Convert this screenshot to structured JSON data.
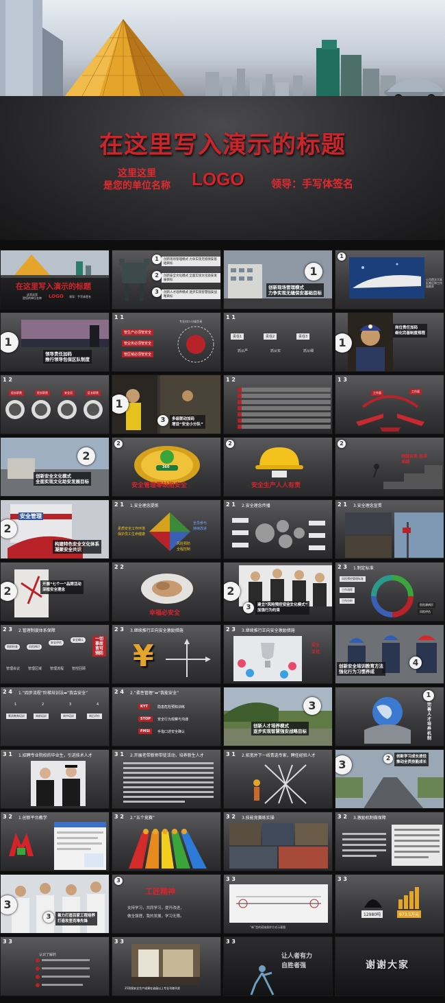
{
  "hero": {
    "title": "在这里写入演示的标题",
    "unit_line1": "这里这里",
    "unit_line2": "是您的单位名称",
    "logo": "LOGO",
    "leader": "领导：手写体签名"
  },
  "colors": {
    "accent_red": "#d4262c",
    "gold": "#e4a52a",
    "background": "#1b1b1d"
  },
  "slides": {
    "s1": {
      "title": "在这里写入演示的标题",
      "unit_a": "这里这里",
      "unit_b": "是您的单位名称",
      "logo": "LOGO",
      "leader": "领导：手写体签名"
    },
    "s2": {
      "items": [
        "创新现场管理模式 力争实现无缝保安基础目标",
        "创新安全文化模式 全面实现文化助安发展目标",
        "创新人才培养模式 逐步实现智慧强安战略目标"
      ],
      "nums": [
        "1",
        "2",
        "3"
      ]
    },
    "s3": {
      "num": "1",
      "line1": "创新现场管理模式",
      "line2": "力争实现无缝保安基础目标"
    },
    "s4": {
      "num": "1",
      "side": "公司首次大采区搬迁和工作面搬家"
    },
    "s5": {
      "num": "1",
      "line1": "领导责任加码",
      "line2": "推行领导包保区队制度"
    },
    "s6": {
      "num": "1 1",
      "items": [
        "管生产必须管安全",
        "管业务必须管安全",
        "管区域必须管安全"
      ],
      "ring": "专业对口·分级负责"
    },
    "s7": {
      "num": "1 1",
      "steps": [
        "责任1",
        "责任2",
        "责任3"
      ],
      "bottom": [
        "抓从严",
        "抓从实",
        "抓从细"
      ]
    },
    "s8": {
      "num": "1",
      "line1": "岗位责任加码",
      "line2": "细化完善制度规程"
    },
    "s9": {
      "num": "1 2",
      "labels": [
        "组长职责",
        "班长职责",
        "安全员",
        "区长职责"
      ]
    },
    "s10": {
      "num": "3",
      "line1": "多级联动加码",
      "line2": "增设“安全小分队”"
    },
    "s11": {
      "num": "1 2",
      "rows": 7
    },
    "s12": {
      "num": "1 3",
      "tags": [
        "工作面",
        "工作面"
      ]
    },
    "s13": {
      "num": "2",
      "line1": "创新安全文化模式",
      "line2": "全面实现文化助安发展目标"
    },
    "s14": {
      "num": "2",
      "badge": "360",
      "text": "安全管理零缺陷安全"
    },
    "s15": {
      "num": "2",
      "text": "安全生产人人有责"
    },
    "s16": {
      "num": "2",
      "text": "跨越自我 追求卓越"
    },
    "s17": {
      "num": "2",
      "logo_text": "安全管理",
      "line1": "构建特色安全文化体系",
      "line2": "凝聚安全共识"
    },
    "s18": {
      "num": "2 1",
      "hdr": "1.安全理念提炼",
      "left1": "素质安全工作环境",
      "left2": "保护员工生命健康",
      "right1": "全员参与",
      "right2": "持续改进",
      "bottom1": "风险预防",
      "bottom2": "全程控制"
    },
    "s19": {
      "num": "2 1",
      "hdr": "2.安全理念传播"
    },
    "s20": {
      "num": "2 1",
      "hdr": "3.安全理念宣贯"
    },
    "s21": {
      "num": "2",
      "line1": "开展“七个一”品牌活动",
      "line2": "深植安全理念"
    },
    "s22": {
      "num": "2 2",
      "text": "幸福必安全"
    },
    "s23": {
      "num": "3",
      "line1": "建立“风险预控安全文化模式”",
      "line2": "加强行为约束"
    },
    "s24": {
      "num": "2 3",
      "hdr": "1.制定标准",
      "boxes": [
        "风险预控管理标准",
        "工作流程",
        "工作分析"
      ],
      "right": [
        "危险源辨识",
        "风险评估"
      ]
    },
    "s25": {
      "num": "2 3",
      "hdr": "2.管理制度体系保障",
      "circles": [
        "岗前检查",
        "风险辨识",
        "安全评估",
        "安全确认"
      ],
      "labels": [
        "管理会议",
        "管理区域",
        "管理流程",
        "管控回顾"
      ],
      "banner": "一切事故皆可预防"
    },
    "s26": {
      "num": "2 3",
      "hdr": "3.继续推行正向安全激励措施"
    },
    "s27": {
      "num": "2 3",
      "hdr": "3.继续推行正向安全激励措施",
      "side1": "安全",
      "side2": "文化"
    },
    "s28": {
      "num": "4",
      "line1": "创新安全培训教育方法",
      "line2": "强化行为习惯养成"
    },
    "s29": {
      "num": "2 4",
      "hdr": "1.“四步流程”阶梯培训法➡“我会安全”",
      "steps": [
        "素质教育培训",
        "岗前培训",
        "岗中培训",
        "岗后评价"
      ],
      "nums": [
        "1",
        "2",
        "3",
        "4"
      ]
    },
    "s30": {
      "num": "2 4",
      "hdr": "2.“柔性管理”➡“我能安全”",
      "tags": [
        "KYT",
        "STOP",
        "FMSI"
      ],
      "items": [
        "隐患危险预知训练",
        "安全行为观察与沟通",
        "手指口述安全确认"
      ]
    },
    "s31": {
      "num": "3",
      "line1": "创新人才培养模式",
      "line2": "逐步实现智慧强安战略目标"
    },
    "s32": {
      "num": "1",
      "vertical": "完善人才培养机制"
    },
    "s33": {
      "num": "3 1",
      "hdr": "1.招聘专业院校的毕业生，引进技术人才"
    },
    "s34": {
      "num": "3 1",
      "hdr": "2.开展老带新师带徒活动，培养新生人才"
    },
    "s35": {
      "num": "3 1",
      "hdr": "2.拓宽并下一线青选专家，聘任经验人才"
    },
    "s36": {
      "num": "2",
      "line1": "创新学习成长途径",
      "line2": "推动全员技能成长"
    },
    "s37": {
      "num": "3 2",
      "hdr": "1.创新平台教学"
    },
    "s38": {
      "num": "3 2",
      "hdr": "2.“五个竞赛”"
    },
    "s39": {
      "num": "3 2",
      "hdr": "3.技能竞赛练实操"
    },
    "s40": {
      "num": "3 2",
      "hdr": "3.激励机制做保障"
    },
    "s41": {
      "num": "3",
      "line1": "着力打造百家工程培养",
      "line2": "打造攻坚克难先锋"
    },
    "s42": {
      "num": "3",
      "title": "工匠精神",
      "lines": [
        "支持学习，共同学习，提升改进，",
        "做全强理，我的发展，学习无限。"
      ]
    },
    "s43": {
      "num": "3 3",
      "label": "“新”型的初始保护方式示意图"
    },
    "s44": {
      "num": "3 3",
      "val1": "12980吨",
      "val2": "973.5万元"
    },
    "s45": {
      "num": "3 3",
      "items": [
        "认识了解的"
      ]
    },
    "s46": {
      "num": "3 3",
      "caption": "25项保安全生产成果在省级以上专业刊物刊发"
    },
    "s47": {
      "num": "3 3",
      "line1": "让人者有力",
      "line2": "自胜者强"
    },
    "s48": {
      "num": "",
      "text": "谢谢大家"
    }
  }
}
